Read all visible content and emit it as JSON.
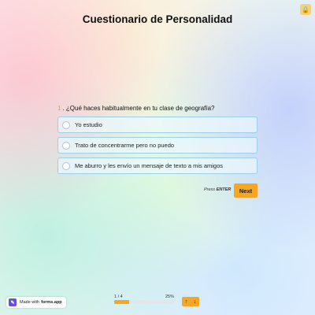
{
  "page": {
    "title": "Cuestionario de Personalidad"
  },
  "corner_button": {
    "icon": "lock-icon",
    "glyph": "🔒"
  },
  "question": {
    "number": "1",
    "text": "¿Qué haces habitualmente en tu clase de geografía?",
    "options": [
      {
        "label": "Yo estudio"
      },
      {
        "label": "Trato de concentrarme pero no puedo"
      },
      {
        "label": "Me aburro y les envío un mensaje de texto a mis amigos"
      }
    ]
  },
  "actions": {
    "press_label": "Press",
    "press_key": "ENTER",
    "next_label": "Next"
  },
  "footer": {
    "badge_prefix": "Made with",
    "badge_brand": "forms.app",
    "progress_label": "1 / 4",
    "progress_percent": "25%",
    "progress_fraction": 0.25,
    "nav_up": "↑",
    "nav_down": "↓"
  },
  "colors": {
    "accent": "#f5a623",
    "option_border": "#9bd0e8"
  }
}
